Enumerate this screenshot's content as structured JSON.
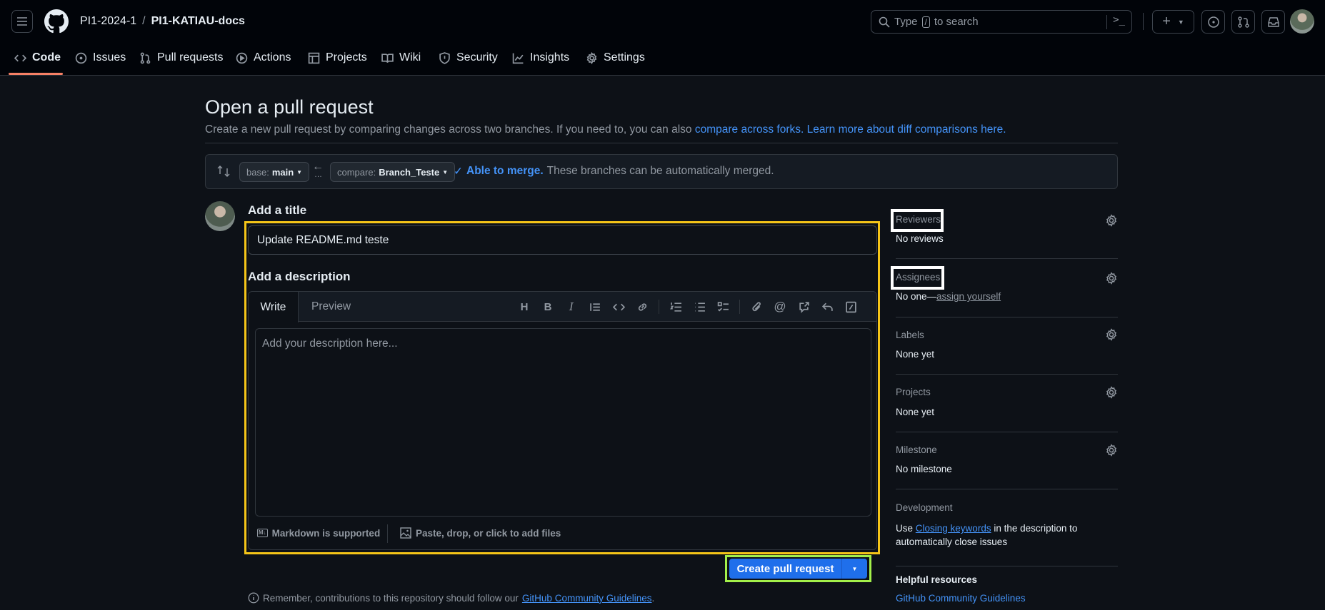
{
  "header": {
    "owner": "PI1-2024-1",
    "separator": "/",
    "repo": "PI1-KATIAU-docs",
    "search": {
      "placeholder_before": "Type",
      "key": "/",
      "placeholder_after": "to search"
    },
    "icons": [
      "hamburger-icon",
      "github-logo",
      "search-icon",
      "command-palette-icon",
      "plus-icon",
      "issues-icon",
      "pull-requests-icon",
      "inbox-icon",
      "avatar"
    ]
  },
  "repo_nav": {
    "tabs": [
      {
        "label": "Code",
        "icon": "code-icon",
        "active": true
      },
      {
        "label": "Issues",
        "icon": "issue-icon"
      },
      {
        "label": "Pull requests",
        "icon": "pull-request-icon"
      },
      {
        "label": "Actions",
        "icon": "play-icon"
      },
      {
        "label": "Projects",
        "icon": "table-icon"
      },
      {
        "label": "Wiki",
        "icon": "book-icon"
      },
      {
        "label": "Security",
        "icon": "shield-icon"
      },
      {
        "label": "Insights",
        "icon": "graph-icon"
      },
      {
        "label": "Settings",
        "icon": "gear-icon"
      }
    ]
  },
  "page": {
    "title": "Open a pull request",
    "subtitle": "Create a new pull request by comparing changes across two branches. If you need to, you can also",
    "link_forks": "compare across forks.",
    "link_learn": "Learn more about diff comparisons here."
  },
  "compare": {
    "base_label": "base:",
    "base_value": "main",
    "compare_label": "compare:",
    "compare_value": "Branch_Teste",
    "status": "Able to merge.",
    "status_detail": "These branches can be automatically merged."
  },
  "form": {
    "title_label": "Add a title",
    "title_value": "Update README.md teste",
    "description_label": "Add a description",
    "tabs": [
      "Write",
      "Preview"
    ],
    "description_placeholder": "Add your description here...",
    "markdown_note": "Markdown is supported",
    "attach_note": "Paste, drop, or click to add files",
    "submit_label": "Create pull request",
    "highlight_color": "#f5c518",
    "submit_highlight_color": "#a3f04a"
  },
  "sidebar": {
    "reviewers": {
      "label": "Reviewers",
      "value": "No reviews"
    },
    "assignees": {
      "label": "Assignees",
      "value": "No one—",
      "link": "assign yourself"
    },
    "labels": {
      "label": "Labels",
      "value": "None yet"
    },
    "projects": {
      "label": "Projects",
      "value": "None yet"
    },
    "milestone": {
      "label": "Milestone",
      "value": "No milestone"
    },
    "development": {
      "label": "Development",
      "text_before": "Use",
      "link": "Closing keywords",
      "text_after": "in the description to",
      "text_line2": "automatically close issues"
    },
    "helpful": {
      "label": "Helpful resources",
      "link": "GitHub Community Guidelines"
    }
  },
  "footer": {
    "text": "Remember, contributions to this repository should follow our",
    "link": "GitHub Community Guidelines",
    "end": "."
  }
}
